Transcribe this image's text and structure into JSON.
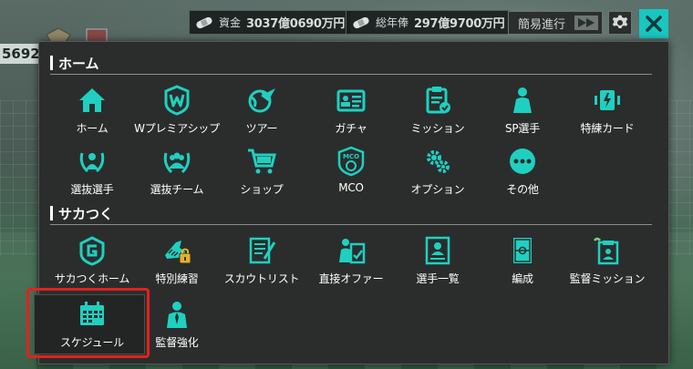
{
  "topbar": {
    "funds_label": "資金",
    "funds_value": "3037億0690万円",
    "salary_label": "総年俸",
    "salary_value": "297億9700万円",
    "easy_progress_label": "簡易進行"
  },
  "background": {
    "left_score": "5692"
  },
  "home_section": {
    "title": "ホーム",
    "items": [
      {
        "label": "ホーム",
        "icon": "house-icon"
      },
      {
        "label": "Wプレミアシップ",
        "icon": "w-badge-icon"
      },
      {
        "label": "ツアー",
        "icon": "globe-plane-icon"
      },
      {
        "label": "ガチャ",
        "icon": "id-card-icon"
      },
      {
        "label": "ミッション",
        "icon": "clipboard-check-icon"
      },
      {
        "label": "SP選手",
        "icon": "player-icon"
      },
      {
        "label": "特練カード",
        "icon": "card-icon"
      },
      {
        "label": "選抜選手",
        "icon": "laurel-player-icon"
      },
      {
        "label": "選抜チーム",
        "icon": "laurel-team-icon"
      },
      {
        "label": "ショップ",
        "icon": "cart-icon"
      },
      {
        "label": "MCO",
        "icon": "mco-shield-icon"
      },
      {
        "label": "オプション",
        "icon": "gears-icon"
      },
      {
        "label": "その他",
        "icon": "more-icon"
      }
    ]
  },
  "sakatsuku_section": {
    "title": "サカつく",
    "items": [
      {
        "label": "サカつくホーム",
        "icon": "sakatsuku-logo-icon"
      },
      {
        "label": "特別練習",
        "icon": "locked-boot-icon"
      },
      {
        "label": "スカウトリスト",
        "icon": "scout-list-icon"
      },
      {
        "label": "直接オファー",
        "icon": "offer-icon"
      },
      {
        "label": "選手一覧",
        "icon": "player-list-icon"
      },
      {
        "label": "編成",
        "icon": "formation-icon"
      },
      {
        "label": "監督ミッション",
        "icon": "manager-mission-icon"
      },
      {
        "label": "スケジュール",
        "icon": "calendar-icon"
      },
      {
        "label": "監督強化",
        "icon": "manager-icon"
      }
    ]
  },
  "colors": {
    "accent": "#19c6c1",
    "panel": "#2b2d2d",
    "highlight": "#e3211d"
  }
}
